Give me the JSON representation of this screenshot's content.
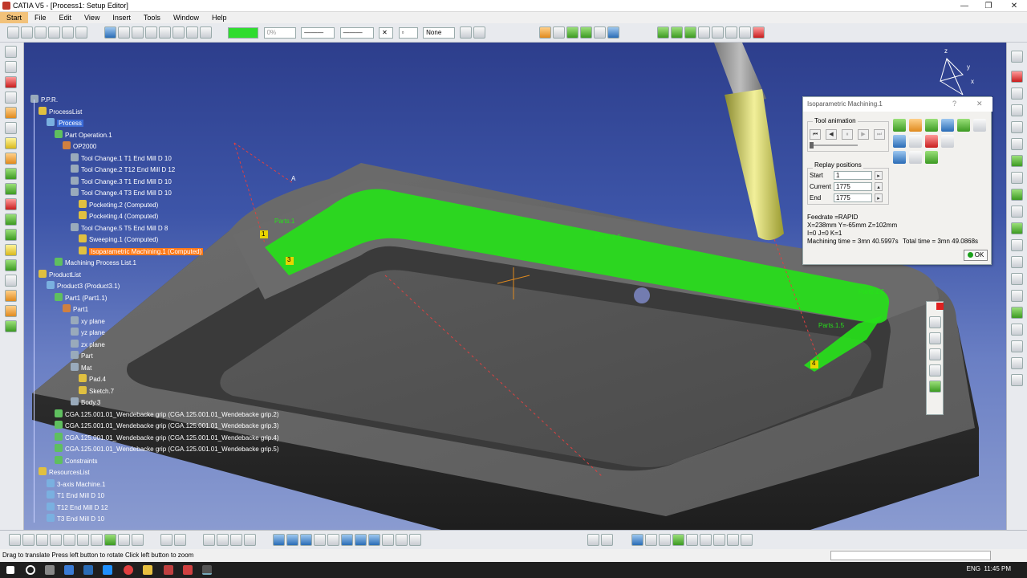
{
  "title": "CATIA V5 - [Process1: Setup Editor]",
  "menu": [
    "Start",
    "File",
    "Edit",
    "View",
    "Insert",
    "Tools",
    "Window",
    "Help"
  ],
  "toolbar": {
    "percent": "0%",
    "none_label": "None"
  },
  "tree": [
    {
      "label": "P.P.R.",
      "level": 0
    },
    {
      "label": "ProcessList",
      "level": 1
    },
    {
      "label": "Process",
      "level": 2,
      "hl": "blue"
    },
    {
      "label": "Part Operation.1",
      "level": 3
    },
    {
      "label": "OP2000",
      "level": 4
    },
    {
      "label": "Tool Change.1  T1 End Mill D 10",
      "level": 5
    },
    {
      "label": "Tool Change.2  T12 End Mill D 12",
      "level": 5
    },
    {
      "label": "Tool Change.3  T1 End Mill D 10",
      "level": 5
    },
    {
      "label": "Tool Change.4  T3 End Mill D 10",
      "level": 5
    },
    {
      "label": "Pocketing.2 (Computed)",
      "level": 6
    },
    {
      "label": "Pocketing.4 (Computed)",
      "level": 6
    },
    {
      "label": "Tool Change.5  T5 End Mill D 8",
      "level": 5
    },
    {
      "label": "Sweeping.1 (Computed)",
      "level": 6
    },
    {
      "label": "Isoparametric Machining.1 (Computed)",
      "level": 6,
      "hl": "orange"
    },
    {
      "label": "Machining Process List.1",
      "level": 3
    },
    {
      "label": "ProductList",
      "level": 1
    },
    {
      "label": "Product3 (Product3.1)",
      "level": 2
    },
    {
      "label": "Part1 (Part1.1)",
      "level": 3
    },
    {
      "label": "Part1",
      "level": 4
    },
    {
      "label": "xy plane",
      "level": 5
    },
    {
      "label": "yz plane",
      "level": 5
    },
    {
      "label": "zx plane",
      "level": 5
    },
    {
      "label": "Part",
      "level": 5
    },
    {
      "label": "Mat",
      "level": 5
    },
    {
      "label": "Pad.4",
      "level": 6
    },
    {
      "label": "Sketch.7",
      "level": 6
    },
    {
      "label": "Body.3",
      "level": 5
    },
    {
      "label": "CGA.125.001.01_Wendebacke grip (CGA.125.001.01_Wendebacke grip.2)",
      "level": 3
    },
    {
      "label": "CGA.125.001.01_Wendebacke grip (CGA.125.001.01_Wendebacke grip.3)",
      "level": 3
    },
    {
      "label": "CGA.125.001.01_Wendebacke grip (CGA.125.001.01_Wendebacke grip.4)",
      "level": 3
    },
    {
      "label": "CGA.125.001.01_Wendebacke grip (CGA.125.001.01_Wendebacke grip.5)",
      "level": 3
    },
    {
      "label": "Constraints",
      "level": 3
    },
    {
      "label": "ResourcesList",
      "level": 1
    },
    {
      "label": "3-axis Machine.1",
      "level": 2
    },
    {
      "label": "T1 End Mill D 10",
      "level": 2
    },
    {
      "label": "T12 End Mill D 12",
      "level": 2
    },
    {
      "label": "T3 End Mill D 10",
      "level": 2
    }
  ],
  "panel": {
    "title": "Isoparametric Machining.1",
    "help": "?",
    "close": "✕",
    "tool_animation": "Tool animation",
    "replay_positions": "Replay positions",
    "start_label": "Start",
    "start_val": "1",
    "current_label": "Current",
    "current_val": "1775",
    "end_label": "End",
    "end_val": "1775",
    "feedrate": "Feedrate =RAPID",
    "coords": "X=238mm Y=-65mm Z=102mm",
    "ijk": "I=0 J=0 K=1",
    "mtime": "Machining time = 3mn 40.5997s",
    "ttime": "Total time = 3mn 49.0868s",
    "ok": "OK"
  },
  "viewport": {
    "part_labels": [
      "Parts.1",
      "Parts.1.5",
      "Parts.1.6",
      "Parts.1.5"
    ],
    "marker_a": "A",
    "marker_1": "1",
    "marker_3": "3",
    "marker_4": "4",
    "axis_x": "x",
    "axis_y": "y",
    "axis_z": "z"
  },
  "status": "Drag to translate  Press left button to rotate  Click left button to zoom",
  "taskbar": {
    "time": "11:45 PM",
    "lang": "ENG"
  },
  "colors": {
    "toolpath": "#27e01a",
    "part": "#5c5c5c",
    "bg_top": "#2d3e8c",
    "bg_bottom": "#8a9bd0",
    "highlight_orange": "#ff7a1a",
    "highlight_blue": "#3b6bd6"
  }
}
